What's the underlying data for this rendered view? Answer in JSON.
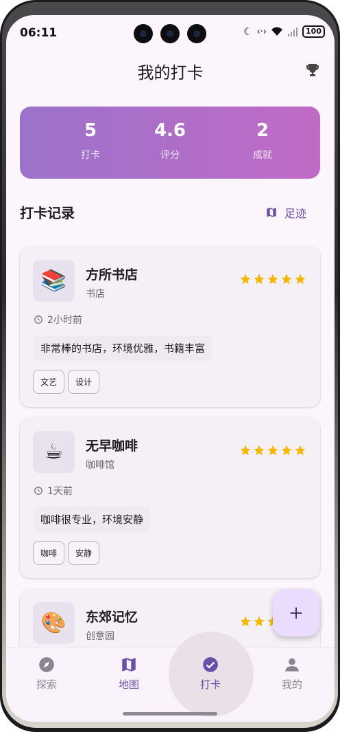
{
  "status_bar": {
    "time": "06:11",
    "battery": "100"
  },
  "header": {
    "title": "我的打卡"
  },
  "stats": [
    {
      "value": "5",
      "label": "打卡"
    },
    {
      "value": "4.6",
      "label": "评分"
    },
    {
      "value": "2",
      "label": "成就"
    }
  ],
  "section": {
    "title": "打卡记录",
    "footprint_label": "足迹"
  },
  "records": [
    {
      "name": "方所书店",
      "category": "书店",
      "emoji": "📚",
      "rating": 5,
      "time": "2小时前",
      "comment": "非常棒的书店，环境优雅，书籍丰富",
      "tags": [
        "文艺",
        "设计"
      ]
    },
    {
      "name": "无早咖啡",
      "category": "咖啡馆",
      "emoji": "☕",
      "rating": 5,
      "time": "1天前",
      "comment": "咖啡很专业，环境安静",
      "tags": [
        "咖啡",
        "安静"
      ]
    },
    {
      "name": "东郊记忆",
      "category": "创意园",
      "emoji": "🎨",
      "rating": 5,
      "time": "",
      "comment": "",
      "tags": []
    }
  ],
  "nav": [
    {
      "label": "探索",
      "icon": "compass-icon"
    },
    {
      "label": "地图",
      "icon": "map-icon"
    },
    {
      "label": "打卡",
      "icon": "check-circle-icon"
    },
    {
      "label": "我的",
      "icon": "person-icon"
    }
  ],
  "colors": {
    "accent": "#6a4fa8",
    "star": "#f5b800",
    "gradient_start": "#9b72cb",
    "gradient_end": "#c06bc6"
  }
}
